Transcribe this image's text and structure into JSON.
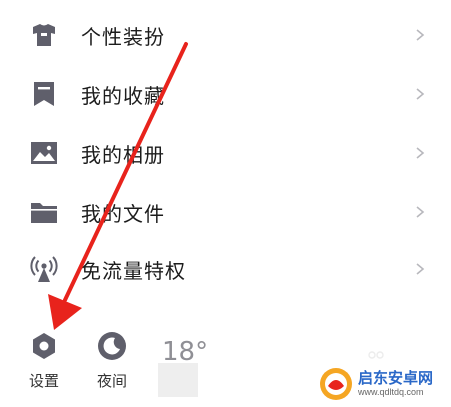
{
  "menu": {
    "items": [
      {
        "label": "个性装扮",
        "icon": "tshirt-icon"
      },
      {
        "label": "我的收藏",
        "icon": "bookmark-icon"
      },
      {
        "label": "我的相册",
        "icon": "image-icon"
      },
      {
        "label": "我的文件",
        "icon": "folder-icon"
      },
      {
        "label": "免流量特权",
        "icon": "signal-tower-icon"
      }
    ]
  },
  "bottom_bar": {
    "settings_label": "设置",
    "night_label": "夜间",
    "temperature": "18°"
  },
  "watermark": {
    "title": "启东安卓网",
    "url": "www.qdltdq.com"
  },
  "colors": {
    "icon_gray": "#5f5f6b",
    "chevron": "#b8b8bd",
    "arrow_red": "#e8231c",
    "text": "#1c1c1c"
  }
}
